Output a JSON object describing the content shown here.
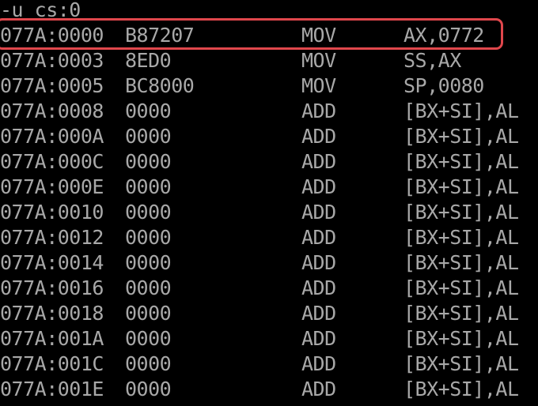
{
  "console": {
    "command": "-u cs:0",
    "rows": [
      {
        "address": "077A:0000",
        "bytes": "B87207",
        "mnemonic": "MOV",
        "operands": "AX,0772"
      },
      {
        "address": "077A:0003",
        "bytes": "8ED0",
        "mnemonic": "MOV",
        "operands": "SS,AX"
      },
      {
        "address": "077A:0005",
        "bytes": "BC8000",
        "mnemonic": "MOV",
        "operands": "SP,0080"
      },
      {
        "address": "077A:0008",
        "bytes": "0000",
        "mnemonic": "ADD",
        "operands": "[BX+SI],AL"
      },
      {
        "address": "077A:000A",
        "bytes": "0000",
        "mnemonic": "ADD",
        "operands": "[BX+SI],AL"
      },
      {
        "address": "077A:000C",
        "bytes": "0000",
        "mnemonic": "ADD",
        "operands": "[BX+SI],AL"
      },
      {
        "address": "077A:000E",
        "bytes": "0000",
        "mnemonic": "ADD",
        "operands": "[BX+SI],AL"
      },
      {
        "address": "077A:0010",
        "bytes": "0000",
        "mnemonic": "ADD",
        "operands": "[BX+SI],AL"
      },
      {
        "address": "077A:0012",
        "bytes": "0000",
        "mnemonic": "ADD",
        "operands": "[BX+SI],AL"
      },
      {
        "address": "077A:0014",
        "bytes": "0000",
        "mnemonic": "ADD",
        "operands": "[BX+SI],AL"
      },
      {
        "address": "077A:0016",
        "bytes": "0000",
        "mnemonic": "ADD",
        "operands": "[BX+SI],AL"
      },
      {
        "address": "077A:0018",
        "bytes": "0000",
        "mnemonic": "ADD",
        "operands": "[BX+SI],AL"
      },
      {
        "address": "077A:001A",
        "bytes": "0000",
        "mnemonic": "ADD",
        "operands": "[BX+SI],AL"
      },
      {
        "address": "077A:001C",
        "bytes": "0000",
        "mnemonic": "ADD",
        "operands": "[BX+SI],AL"
      },
      {
        "address": "077A:001E",
        "bytes": "0000",
        "mnemonic": "ADD",
        "operands": "[BX+SI],AL"
      }
    ]
  },
  "colors": {
    "background": "#000000",
    "text": "#a8a8a8",
    "highlight": "#e0474c"
  }
}
